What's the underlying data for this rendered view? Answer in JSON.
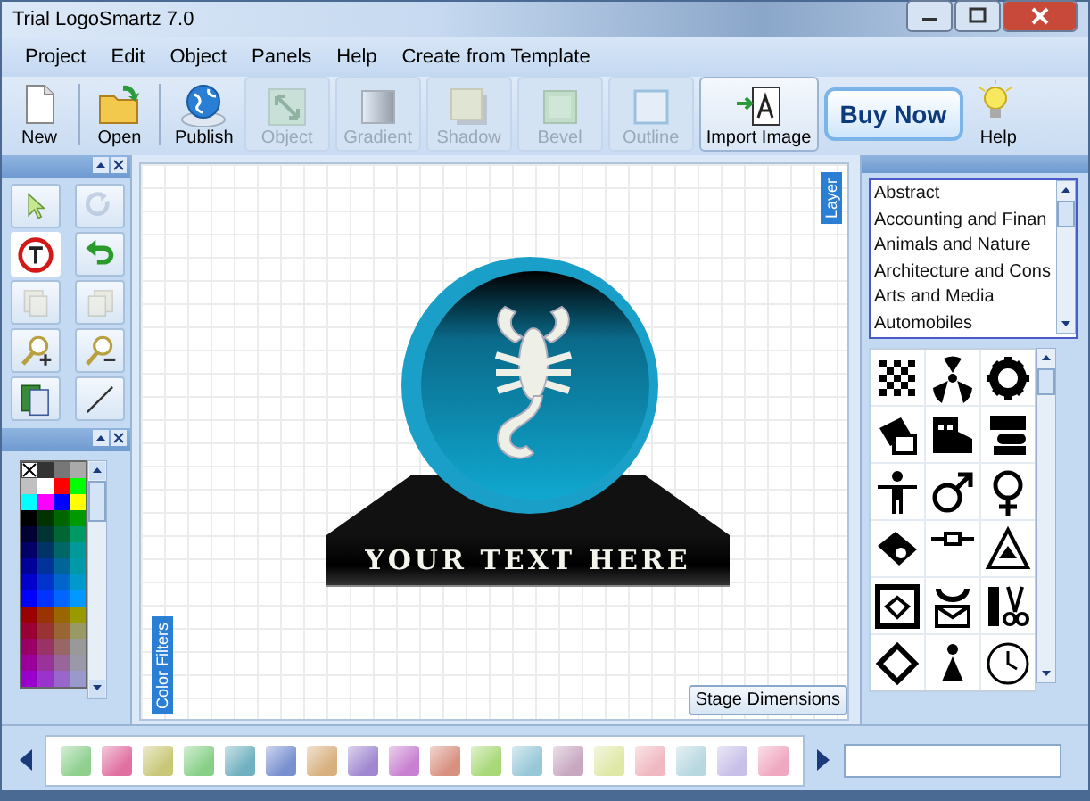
{
  "window": {
    "title": "Trial LogoSmartz 7.0"
  },
  "menu": [
    {
      "label": "Project"
    },
    {
      "label": "Edit"
    },
    {
      "label": "Object"
    },
    {
      "label": "Panels"
    },
    {
      "label": "Help"
    },
    {
      "label": "Create from Template"
    }
  ],
  "toolbar": [
    {
      "kind": "new",
      "label": "New",
      "disabled": false
    },
    {
      "kind": "open",
      "label": "Open",
      "disabled": false
    },
    {
      "kind": "publish",
      "label": "Publish",
      "disabled": false
    },
    {
      "kind": "object",
      "label": "Object",
      "disabled": true
    },
    {
      "kind": "gradient",
      "label": "Gradient",
      "disabled": true
    },
    {
      "kind": "shadow",
      "label": "Shadow",
      "disabled": true
    },
    {
      "kind": "bevel",
      "label": "Bevel",
      "disabled": true
    },
    {
      "kind": "outline",
      "label": "Outline",
      "disabled": true
    },
    {
      "kind": "import",
      "label": "Import Image",
      "disabled": false
    },
    {
      "kind": "buy",
      "label": "Buy Now"
    },
    {
      "kind": "help",
      "label": "Help",
      "disabled": false
    }
  ],
  "tools": [
    {
      "kind": "select",
      "disabled": false,
      "selected": false
    },
    {
      "kind": "redo",
      "disabled": true,
      "selected": false
    },
    {
      "kind": "text",
      "disabled": false,
      "selected": true
    },
    {
      "kind": "undo",
      "disabled": false,
      "selected": false
    },
    {
      "kind": "front",
      "disabled": true,
      "selected": false
    },
    {
      "kind": "back",
      "disabled": true,
      "selected": false
    },
    {
      "kind": "zoom-in",
      "disabled": false,
      "selected": false
    },
    {
      "kind": "zoom-out",
      "disabled": false,
      "selected": false
    },
    {
      "kind": "pages",
      "disabled": false,
      "selected": false
    },
    {
      "kind": "line",
      "disabled": false,
      "selected": false
    }
  ],
  "palette": [
    {
      "kind": "none"
    },
    {
      "color": "#333333"
    },
    {
      "color": "#777777"
    },
    {
      "color": "#aaaaaa"
    },
    {
      "color": "#c0c0c0"
    },
    {
      "color": "#ffffff"
    },
    {
      "color": "#ff0000"
    },
    {
      "color": "#00ff00"
    },
    {
      "color": "#00ffff"
    },
    {
      "color": "#ff00ff"
    },
    {
      "color": "#0000ff"
    },
    {
      "color": "#ffff00"
    },
    {
      "color": "#000000"
    },
    {
      "color": "#003300"
    },
    {
      "color": "#006600"
    },
    {
      "color": "#009900"
    },
    {
      "color": "#000033"
    },
    {
      "color": "#003333"
    },
    {
      "color": "#006633"
    },
    {
      "color": "#009966"
    },
    {
      "color": "#000066"
    },
    {
      "color": "#003366"
    },
    {
      "color": "#006666"
    },
    {
      "color": "#009999"
    },
    {
      "color": "#000099"
    },
    {
      "color": "#003399"
    },
    {
      "color": "#006699"
    },
    {
      "color": "#0099aa"
    },
    {
      "color": "#0000cc"
    },
    {
      "color": "#0033cc"
    },
    {
      "color": "#0066cc"
    },
    {
      "color": "#0099cc"
    },
    {
      "color": "#0000ff"
    },
    {
      "color": "#0033ff"
    },
    {
      "color": "#0066ff"
    },
    {
      "color": "#0099ff"
    },
    {
      "color": "#990000"
    },
    {
      "color": "#993300"
    },
    {
      "color": "#996600"
    },
    {
      "color": "#999900"
    },
    {
      "color": "#990033"
    },
    {
      "color": "#993333"
    },
    {
      "color": "#996633"
    },
    {
      "color": "#999966"
    },
    {
      "color": "#990066"
    },
    {
      "color": "#993366"
    },
    {
      "color": "#996666"
    },
    {
      "color": "#999999"
    },
    {
      "color": "#990099"
    },
    {
      "color": "#993399"
    },
    {
      "color": "#996699"
    },
    {
      "color": "#9999aa"
    },
    {
      "color": "#9900cc"
    },
    {
      "color": "#9933cc"
    },
    {
      "color": "#9966cc"
    },
    {
      "color": "#9999cc"
    }
  ],
  "stage": {
    "layer_tab": "Layer",
    "color_filters_tab": "Color Filters",
    "stage_dimensions": "Stage Dimensions",
    "logo_text": "YOUR TEXT HERE"
  },
  "categories": [
    {
      "label": "Abstract",
      "selected": false
    },
    {
      "label": "Accounting and Finan",
      "selected": false
    },
    {
      "label": "Animals and Nature",
      "selected": false
    },
    {
      "label": "Architecture and Cons",
      "selected": false
    },
    {
      "label": "Arts and Media",
      "selected": false
    },
    {
      "label": "Automobiles",
      "selected": false
    }
  ],
  "gradients": [
    {
      "color": "#8fd08f"
    },
    {
      "color": "#e070a0"
    },
    {
      "color": "#c8c878"
    },
    {
      "color": "#88d088"
    },
    {
      "color": "#70b0c0"
    },
    {
      "color": "#7890d0"
    },
    {
      "color": "#d8b080"
    },
    {
      "color": "#a088d0"
    },
    {
      "color": "#c880d0"
    },
    {
      "color": "#d89080"
    },
    {
      "color": "#a8d878"
    },
    {
      "color": "#98c8d8"
    },
    {
      "color": "#c8a8c0"
    },
    {
      "color": "#e0e8a8"
    },
    {
      "color": "#f0b8c0"
    },
    {
      "color": "#b8d8e0"
    },
    {
      "color": "#c8c0e8"
    },
    {
      "color": "#f0a8c0"
    }
  ]
}
